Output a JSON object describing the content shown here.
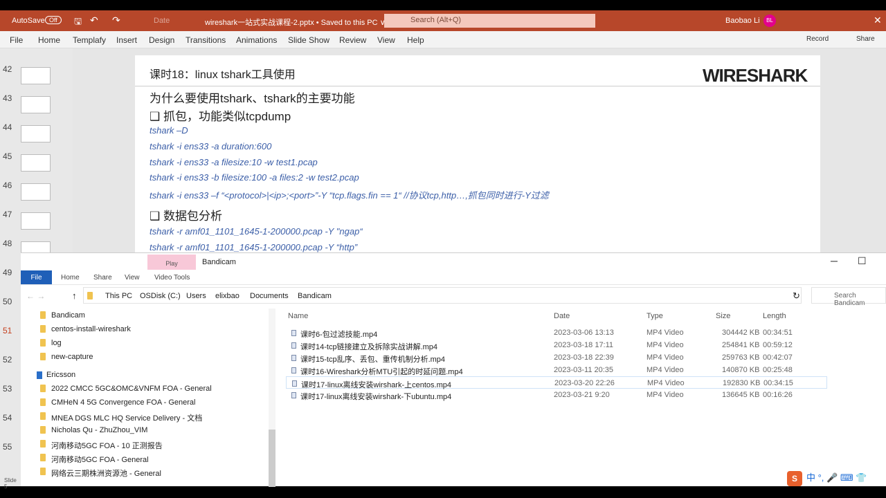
{
  "titlebar": {
    "autosave": "AutoSave",
    "toggle": "Off",
    "date_btn": "Date",
    "doc_title": "wireshark一站式实战课程-2.pptx • Saved to this PC ∨",
    "search_placeholder": "Search (Alt+Q)",
    "user": "Baobao Li",
    "avatar": "BL"
  },
  "ribbon": {
    "tabs": [
      "File",
      "Home",
      "Templafy",
      "Insert",
      "Design",
      "Transitions",
      "Animations",
      "Slide Show",
      "Review",
      "View",
      "Help"
    ],
    "record": "Record",
    "share": "Share"
  },
  "thumbnails": [
    "42",
    "43",
    "44",
    "45",
    "46",
    "47",
    "48",
    "49",
    "50",
    "51",
    "52",
    "53",
    "54",
    "55"
  ],
  "slide": {
    "title": "课时18：linux tshark工具使用",
    "logo": "WIRESHARK",
    "heading": "为什么要使用tshark、tshark的主要功能",
    "bullet1": "❑ 抓包，功能类似tcpdump",
    "cmds1": [
      "tshark –D",
      "tshark -i ens33 -a duration:600",
      "tshark -i ens33 -a filesize:10  -w test1.pcap",
      "tshark -i ens33  -b filesize:100 -a files:2 -w test2.pcap",
      "tshark -i ens33 –f “<protocol>|<ip>;<port>”-Y “tcp.flags.fin == 1“   //协议tcp,http…,抓包同时进行-Y过滤"
    ],
    "bullet2": "❑ 数据包分析",
    "cmds2": [
      "tshark -r amf01_1101_1645-1-200000.pcap -Y \"ngap“",
      "tshark -r amf01_1101_1645-1-200000.pcap -Y “http”"
    ]
  },
  "explorer": {
    "title": "Bandicam",
    "play": "Play",
    "tabs": [
      "File",
      "Home",
      "Share",
      "View",
      "Video Tools"
    ],
    "breadcrumb": [
      "This PC",
      "OSDisk (C:)",
      "Users",
      "elixbao",
      "Documents",
      "Bandicam"
    ],
    "search_placeholder": "Search Bandicam",
    "nav": [
      "Bandicam",
      "centos-install-wireshark",
      "log",
      "new-capture"
    ],
    "nav_group": "Ericsson",
    "nav2": [
      "2022 CMCC 5GC&OMC&VNFM FOA - General",
      "CMHeN 4 5G Convergence FOA - General",
      "MNEA DGS MLC HQ Service Delivery - 文档",
      "Nicholas Qu - ZhuZhou_VIM",
      "河南移动5GC FOA - 10 正测报告",
      "河南移动5GC FOA - General",
      "网络云三期株洲资源池 - General"
    ],
    "columns": [
      "Name",
      "Date",
      "Type",
      "Size",
      "Length"
    ],
    "files": [
      {
        "name": "课时6-包过滤技能.mp4",
        "date": "2023-03-06 13:13",
        "type": "MP4 Video",
        "size": "304442 KB",
        "length": "00:34:51"
      },
      {
        "name": "课时14-tcp链接建立及拆除实战讲解.mp4",
        "date": "2023-03-18 17:11",
        "type": "MP4 Video",
        "size": "254841 KB",
        "length": "00:59:12"
      },
      {
        "name": "课时15-tcp乱序、丢包、重传机制分析.mp4",
        "date": "2023-03-18 22:39",
        "type": "MP4 Video",
        "size": "259763 KB",
        "length": "00:42:07"
      },
      {
        "name": "课时16-Wireshark分析MTU引起的时延问题.mp4",
        "date": "2023-03-11 20:35",
        "type": "MP4 Video",
        "size": "140870 KB",
        "length": "00:25:48"
      },
      {
        "name": "课时17-linux离线安装wirshark-上centos.mp4",
        "date": "2023-03-20 22:26",
        "type": "MP4 Video",
        "size": "192830 KB",
        "length": "00:34:15"
      },
      {
        "name": "课时17-linux离线安装wirshark-下ubuntu.mp4",
        "date": "2023-03-21 9:20",
        "type": "MP4 Video",
        "size": "136645 KB",
        "length": "00:16:26"
      }
    ]
  },
  "status": "Slide 5",
  "ime": "中 °, 🎤 ⌨ 👕"
}
